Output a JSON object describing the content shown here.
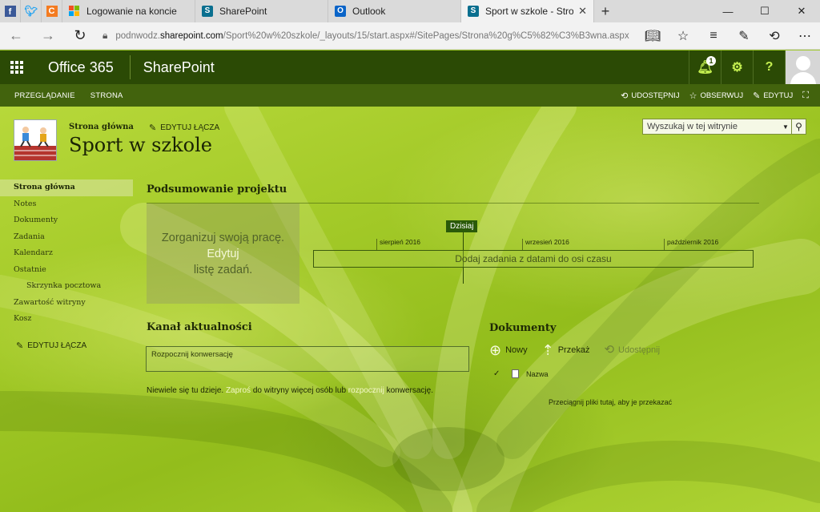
{
  "browser": {
    "tabs": [
      {
        "label": "Logowanie na koncie",
        "icon": "microsoft-logo"
      },
      {
        "label": "SharePoint",
        "icon": "sharepoint-logo"
      },
      {
        "label": "Outlook",
        "icon": "outlook-logo"
      },
      {
        "label": "Sport w szkole - Strona",
        "icon": "sharepoint-logo",
        "active": true
      }
    ],
    "url_prefix": "podnwodz.",
    "url_host": "sharepoint.com",
    "url_path": "/Sport%20w%20szkole/_layouts/15/start.aspx#/SitePages/Strona%20g%C5%82%C3%B3wna.aspx"
  },
  "suite": {
    "brand": "Office 365",
    "app": "SharePoint",
    "notification_count": "1",
    "settings_glyph": "⚙",
    "help_glyph": "?"
  },
  "ribbon": {
    "tabs": [
      "PRZEGLĄDANIE",
      "STRONA"
    ],
    "share": "UDOSTĘPNIJ",
    "follow": "OBSERWUJ",
    "edit": "EDYTUJ"
  },
  "site": {
    "breadcrumb": "Strona główna",
    "edit_links": "EDYTUJ ŁĄCZA",
    "title": "Sport w szkole",
    "search_placeholder": "Wyszukaj w tej witrynie"
  },
  "nav": {
    "items": [
      {
        "label": "Strona główna",
        "selected": true
      },
      {
        "label": "Notes"
      },
      {
        "label": "Dokumenty"
      },
      {
        "label": "Zadania"
      },
      {
        "label": "Kalendarz"
      },
      {
        "label": "Ostatnie"
      },
      {
        "label": "Skrzynka pocztowa",
        "sub": true
      },
      {
        "label": "Zawartość witryny"
      },
      {
        "label": "Kosz"
      }
    ],
    "edit_links": "EDYTUJ ŁĄCZA"
  },
  "project": {
    "title": "Podsumowanie projektu",
    "organize_line1": "Zorganizuj swoją pracę.",
    "organize_link": "Edytuj",
    "organize_line3": "listę zadań.",
    "today": "Dzisiaj",
    "months": [
      "sierpień 2016",
      "wrzesień 2016",
      "październik 2016"
    ],
    "timeline_hint": "Dodaj zadania z datami do osi czasu"
  },
  "news": {
    "title": "Kanał aktualności",
    "placeholder": "Rozpocznij konwersację",
    "empty_1": "Niewiele się tu dzieje. ",
    "empty_link1": "Zaproś",
    "empty_2": " do witryny więcej osób lub ",
    "empty_link2": "rozpocznij",
    "empty_3": " konwersację."
  },
  "documents": {
    "title": "Dokumenty",
    "new": "Nowy",
    "upload": "Przekaż",
    "share": "Udostępnij",
    "column_name": "Nazwa",
    "drop_hint": "Przeciągnij pliki tutaj, aby je przekazać"
  },
  "colors": {
    "suitebar": "#2b4a05",
    "accent": "#c4ef50",
    "background": "#9fc92a"
  }
}
